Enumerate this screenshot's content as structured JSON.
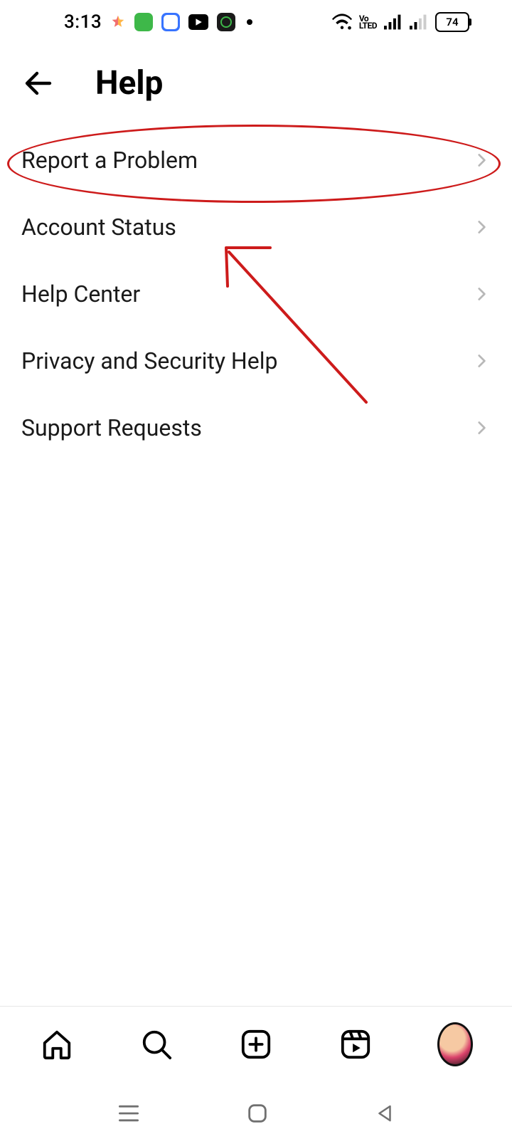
{
  "status_bar": {
    "time": "3:13",
    "volte": "Vo\nLTED",
    "battery": "74"
  },
  "header": {
    "title": "Help"
  },
  "menu": {
    "items": [
      {
        "label": "Report a Problem"
      },
      {
        "label": "Account Status"
      },
      {
        "label": "Help Center"
      },
      {
        "label": "Privacy and Security Help"
      },
      {
        "label": "Support Requests"
      }
    ]
  },
  "annotation": {
    "highlighted_item_index": 0,
    "color": "#cd1b1b"
  }
}
